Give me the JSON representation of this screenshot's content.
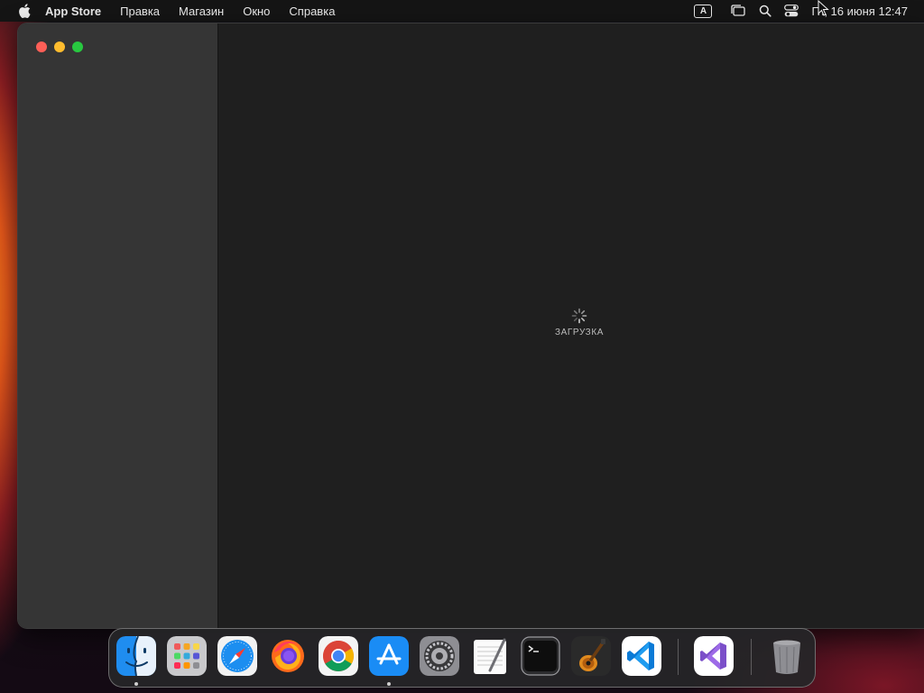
{
  "menubar": {
    "apple_icon": "apple-icon",
    "app_name": "App Store",
    "items": [
      "Правка",
      "Магазин",
      "Окно",
      "Справка"
    ],
    "input_source": "A",
    "status_icons": [
      "stage-manager-icon",
      "spotlight-search-icon",
      "control-center-icon"
    ],
    "clock": "Пт, 16 июня  12:47"
  },
  "window": {
    "loading_text": "ЗАГРУЗКА"
  },
  "dock": {
    "apps": [
      {
        "name": "Finder",
        "icon": "finder-icon",
        "running": true
      },
      {
        "name": "Launchpad",
        "icon": "launchpad-icon",
        "running": false
      },
      {
        "name": "Safari",
        "icon": "safari-icon",
        "running": false
      },
      {
        "name": "Firefox",
        "icon": "firefox-icon",
        "running": false
      },
      {
        "name": "Google Chrome",
        "icon": "chrome-icon",
        "running": false
      },
      {
        "name": "App Store",
        "icon": "app-store-icon",
        "running": true
      },
      {
        "name": "System Settings",
        "icon": "system-settings-icon",
        "running": false
      },
      {
        "name": "TextEdit",
        "icon": "textedit-icon",
        "running": false
      },
      {
        "name": "Terminal",
        "icon": "terminal-icon",
        "running": false
      },
      {
        "name": "GarageBand",
        "icon": "garageband-icon",
        "running": false
      },
      {
        "name": "Visual Studio Code",
        "icon": "vscode-icon",
        "running": false
      },
      {
        "name": "Visual Studio",
        "icon": "visual-studio-icon",
        "running": false
      },
      {
        "name": "Trash",
        "icon": "trash-icon",
        "running": false
      }
    ]
  },
  "colors": {
    "close": "#fe5f57",
    "minimize": "#febc2e",
    "maximize": "#28c840",
    "menubar_bg": "#151515",
    "sidebar_bg": "#353535",
    "content_bg": "#1f1f1f"
  }
}
